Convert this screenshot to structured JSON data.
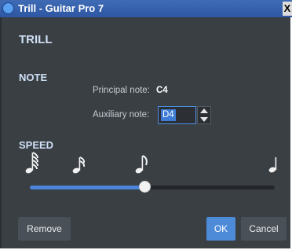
{
  "window": {
    "title": "Trill - Guitar Pro 7",
    "close_label": "X"
  },
  "dialog": {
    "heading": "TRILL",
    "note_section": {
      "heading": "NOTE",
      "principal_label": "Principal note:",
      "principal_value": "C4",
      "auxiliary_label": "Auxiliary note:",
      "auxiliary_value": "D4"
    },
    "speed_section": {
      "heading": "SPEED",
      "note_icons": [
        "sixty-fourth-note-icon",
        "thirty-second-note-icon",
        "sixteenth-note-icon",
        "quarter-note-icon"
      ],
      "slider_fraction": 0.47
    },
    "buttons": {
      "remove": "Remove",
      "ok": "OK",
      "cancel": "Cancel"
    }
  },
  "colors": {
    "background": "#3a3f44",
    "heading": "#cfe0f5",
    "accent": "#4c84d8"
  }
}
